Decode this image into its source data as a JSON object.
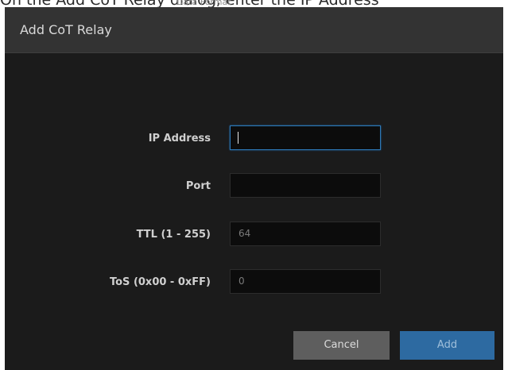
{
  "doc": {
    "caption": "On the Add CoT Relay dialog, enter the IP Address",
    "behind_text": "Data Format"
  },
  "dialog": {
    "title": "Add CoT Relay",
    "fields": [
      {
        "label": "IP Address",
        "value": "",
        "placeholder": "",
        "focused": true
      },
      {
        "label": "Port",
        "value": "",
        "placeholder": ""
      },
      {
        "label": "TTL (1 - 255)",
        "value": "64",
        "placeholder": ""
      },
      {
        "label": "ToS (0x00 - 0xFF)",
        "value": "0",
        "placeholder": ""
      }
    ],
    "buttons": {
      "cancel": "Cancel",
      "add": "Add"
    }
  },
  "colors": {
    "dialog_bg": "#1b1b1b",
    "header_bg": "#333333",
    "input_bg": "#0c0c0c",
    "focus_border": "#2d79b9",
    "cancel_bg": "#5e5e5e",
    "add_bg": "#2d6aa1"
  }
}
